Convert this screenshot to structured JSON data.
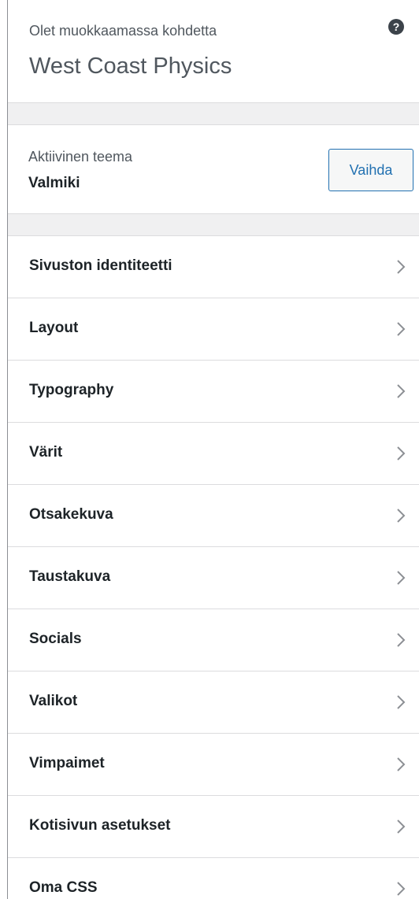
{
  "header": {
    "editing_label": "Olet muokkaamassa kohdetta",
    "site_title": "West Coast Physics",
    "help_icon": "?"
  },
  "theme": {
    "label": "Aktiivinen teema",
    "name": "Valmiki",
    "change_label": "Vaihda"
  },
  "menu": {
    "items": [
      {
        "label": "Sivuston identiteetti",
        "icon": "chevron-right-icon"
      },
      {
        "label": "Layout",
        "icon": "chevron-right-icon"
      },
      {
        "label": "Typography",
        "icon": "chevron-right-icon"
      },
      {
        "label": "Värit",
        "icon": "chevron-right-icon"
      },
      {
        "label": "Otsakekuva",
        "icon": "chevron-right-icon"
      },
      {
        "label": "Taustakuva",
        "icon": "chevron-right-icon"
      },
      {
        "label": "Socials",
        "icon": "chevron-right-icon"
      },
      {
        "label": "Valikot",
        "icon": "chevron-right-icon"
      },
      {
        "label": "Vimpaimet",
        "icon": "chevron-right-icon"
      },
      {
        "label": "Kotisivun asetukset",
        "icon": "chevron-right-icon"
      },
      {
        "label": "Oma CSS",
        "icon": "chevron-right-icon"
      }
    ]
  },
  "colors": {
    "accent": "#2271b1",
    "divider": "#dcdcde",
    "section_gap": "#f0f0f1"
  }
}
